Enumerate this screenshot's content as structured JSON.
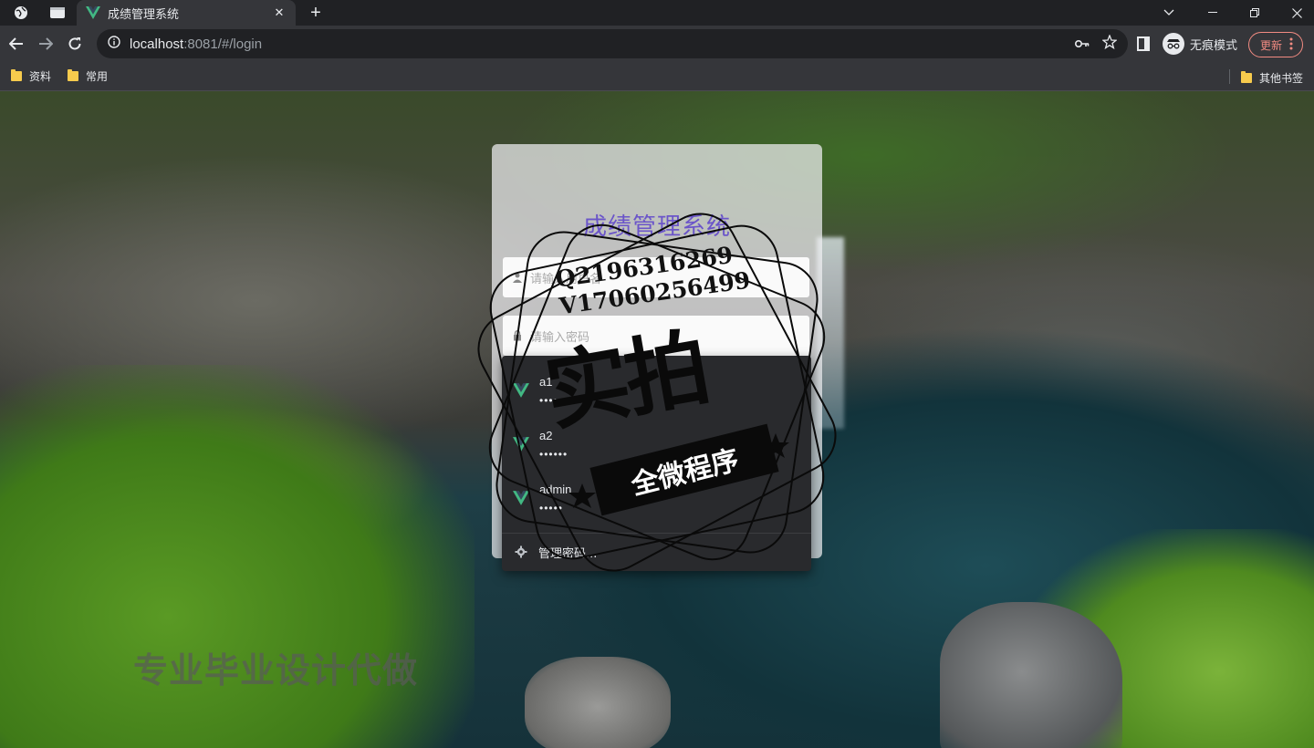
{
  "browser": {
    "tab_title": "成绩管理系统",
    "url_host": "localhost",
    "url_rest": ":8081/#/login",
    "incognito_label": "无痕模式",
    "update_label": "更新"
  },
  "bookmarks": {
    "items": [
      "资料",
      "常用"
    ],
    "other": "其他书签"
  },
  "login": {
    "title": "成绩管理系统",
    "username_placeholder": "请输入用户名",
    "password_placeholder": "请输入密码"
  },
  "autofill": {
    "credentials": [
      {
        "username": "a1",
        "password_mask": "••••••"
      },
      {
        "username": "a2",
        "password_mask": "••••••"
      },
      {
        "username": "admin",
        "password_mask": "•••••"
      }
    ],
    "manage_label": "管理密码..."
  },
  "watermark": {
    "contact": "Q2196316269\nV17060256499",
    "big": "实拍",
    "banner": "全微程序",
    "bottom": "专业毕业设计代做"
  },
  "colors": {
    "vue_green": "#42b883",
    "vue_dark": "#35495e",
    "title_purple": "#6b55c9",
    "update_red": "#f28b82"
  }
}
